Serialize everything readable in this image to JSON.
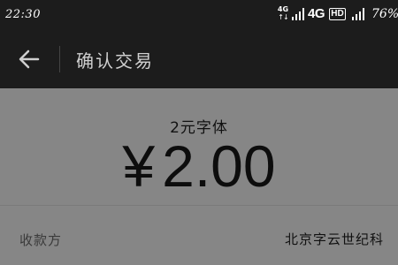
{
  "status_bar": {
    "time": "22:30",
    "network_small": "4G",
    "network_small_arrows": "↑↓",
    "network": "4G",
    "hd_badge": "HD",
    "battery": "76%"
  },
  "header": {
    "back_icon": "arrow-left-icon",
    "title": "确认交易"
  },
  "amount_panel": {
    "font_label": "2元字体",
    "currency_symbol": "¥",
    "amount": "2.00"
  },
  "payee": {
    "label": "收款方",
    "value": "北京字云世纪科"
  },
  "colors": {
    "header_bg": "#1c1c1c",
    "body_bg": "#868686"
  }
}
